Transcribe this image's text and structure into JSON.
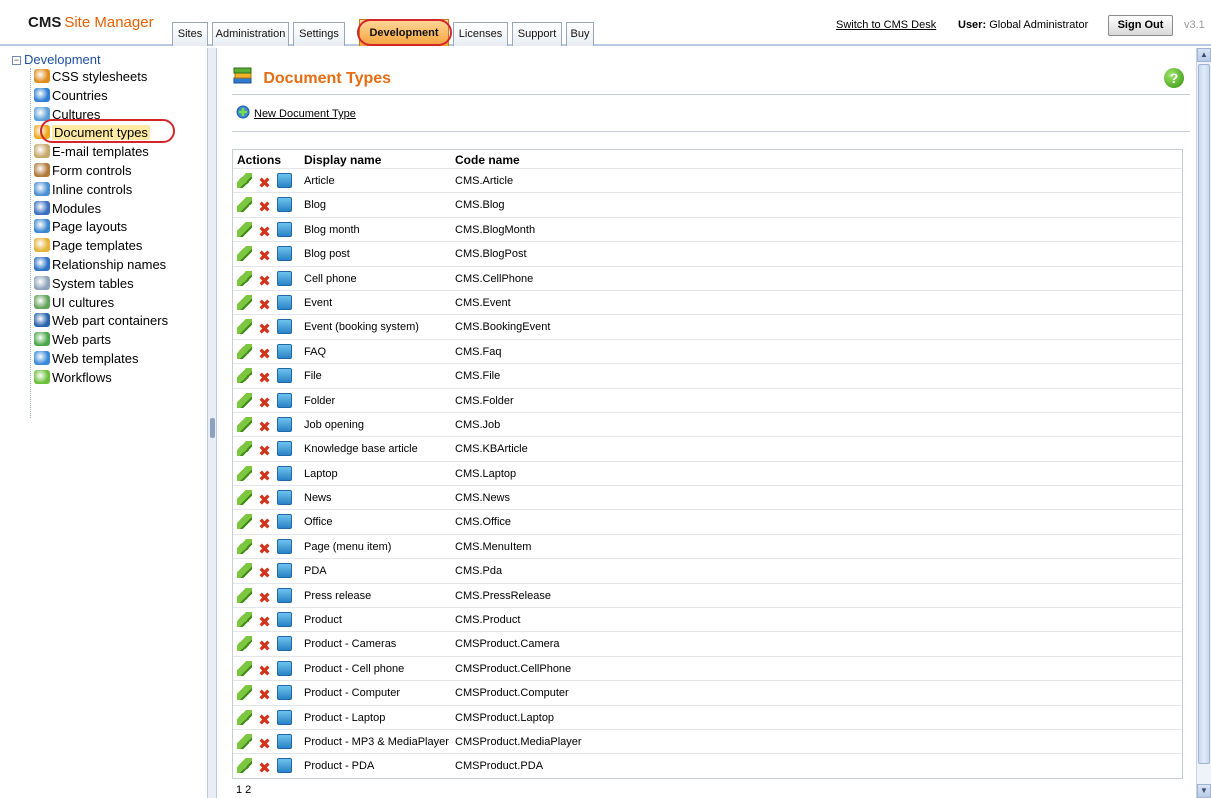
{
  "header": {
    "logo_bold": "CMS",
    "logo_rest": "Site Manager",
    "tabs": [
      "Sites",
      "Administration",
      "Settings",
      "Development",
      "Licenses",
      "Support",
      "Buy"
    ],
    "switch_link": "Switch to CMS Desk",
    "user_label": "User:",
    "user_name": "Global Administrator",
    "sign_out": "Sign Out",
    "version": "v3.1"
  },
  "sidebar": {
    "root": "Development",
    "items": [
      {
        "label": "CSS stylesheets",
        "icon": "css-icon"
      },
      {
        "label": "Countries",
        "icon": "globe-icon"
      },
      {
        "label": "Cultures",
        "icon": "culture-icon"
      },
      {
        "label": "Document types",
        "icon": "document-types-icon"
      },
      {
        "label": "E-mail templates",
        "icon": "email-icon"
      },
      {
        "label": "Form controls",
        "icon": "form-control-icon"
      },
      {
        "label": "Inline controls",
        "icon": "inline-control-icon"
      },
      {
        "label": "Modules",
        "icon": "modules-icon"
      },
      {
        "label": "Page layouts",
        "icon": "page-layout-icon"
      },
      {
        "label": "Page templates",
        "icon": "page-template-icon"
      },
      {
        "label": "Relationship names",
        "icon": "relationship-icon"
      },
      {
        "label": "System tables",
        "icon": "table-icon"
      },
      {
        "label": "UI cultures",
        "icon": "ui-culture-icon"
      },
      {
        "label": "Web part containers",
        "icon": "container-icon"
      },
      {
        "label": "Web parts",
        "icon": "webpart-icon"
      },
      {
        "label": "Web templates",
        "icon": "web-template-icon"
      },
      {
        "label": "Workflows",
        "icon": "workflow-icon"
      }
    ]
  },
  "main": {
    "title": "Document Types",
    "new_link": "New Document Type",
    "columns": {
      "actions": "Actions",
      "display": "Display name",
      "code": "Code name"
    },
    "rows": [
      {
        "display": "Article",
        "code": "CMS.Article"
      },
      {
        "display": "Blog",
        "code": "CMS.Blog"
      },
      {
        "display": "Blog month",
        "code": "CMS.BlogMonth"
      },
      {
        "display": "Blog post",
        "code": "CMS.BlogPost"
      },
      {
        "display": "Cell phone",
        "code": "CMS.CellPhone"
      },
      {
        "display": "Event",
        "code": "CMS.Event"
      },
      {
        "display": "Event (booking system)",
        "code": "CMS.BookingEvent"
      },
      {
        "display": "FAQ",
        "code": "CMS.Faq"
      },
      {
        "display": "File",
        "code": "CMS.File"
      },
      {
        "display": "Folder",
        "code": "CMS.Folder"
      },
      {
        "display": "Job opening",
        "code": "CMS.Job"
      },
      {
        "display": "Knowledge base article",
        "code": "CMS.KBArticle"
      },
      {
        "display": "Laptop",
        "code": "CMS.Laptop"
      },
      {
        "display": "News",
        "code": "CMS.News"
      },
      {
        "display": "Office",
        "code": "CMS.Office"
      },
      {
        "display": "Page (menu item)",
        "code": "CMS.MenuItem"
      },
      {
        "display": "PDA",
        "code": "CMS.Pda"
      },
      {
        "display": "Press release",
        "code": "CMS.PressRelease"
      },
      {
        "display": "Product",
        "code": "CMS.Product"
      },
      {
        "display": "Product - Cameras",
        "code": "CMSProduct.Camera"
      },
      {
        "display": "Product - Cell phone",
        "code": "CMSProduct.CellPhone"
      },
      {
        "display": "Product - Computer",
        "code": "CMSProduct.Computer"
      },
      {
        "display": "Product - Laptop",
        "code": "CMSProduct.Laptop"
      },
      {
        "display": "Product - MP3 & MediaPlayer",
        "code": "CMSProduct.MediaPlayer"
      },
      {
        "display": "Product - PDA",
        "code": "CMSProduct.PDA"
      }
    ],
    "pager": [
      "1",
      "2"
    ]
  },
  "colors": {
    "accent_orange": "#e56d13",
    "link_blue": "#1d4fa3",
    "highlight_ring": "#d3262b"
  }
}
